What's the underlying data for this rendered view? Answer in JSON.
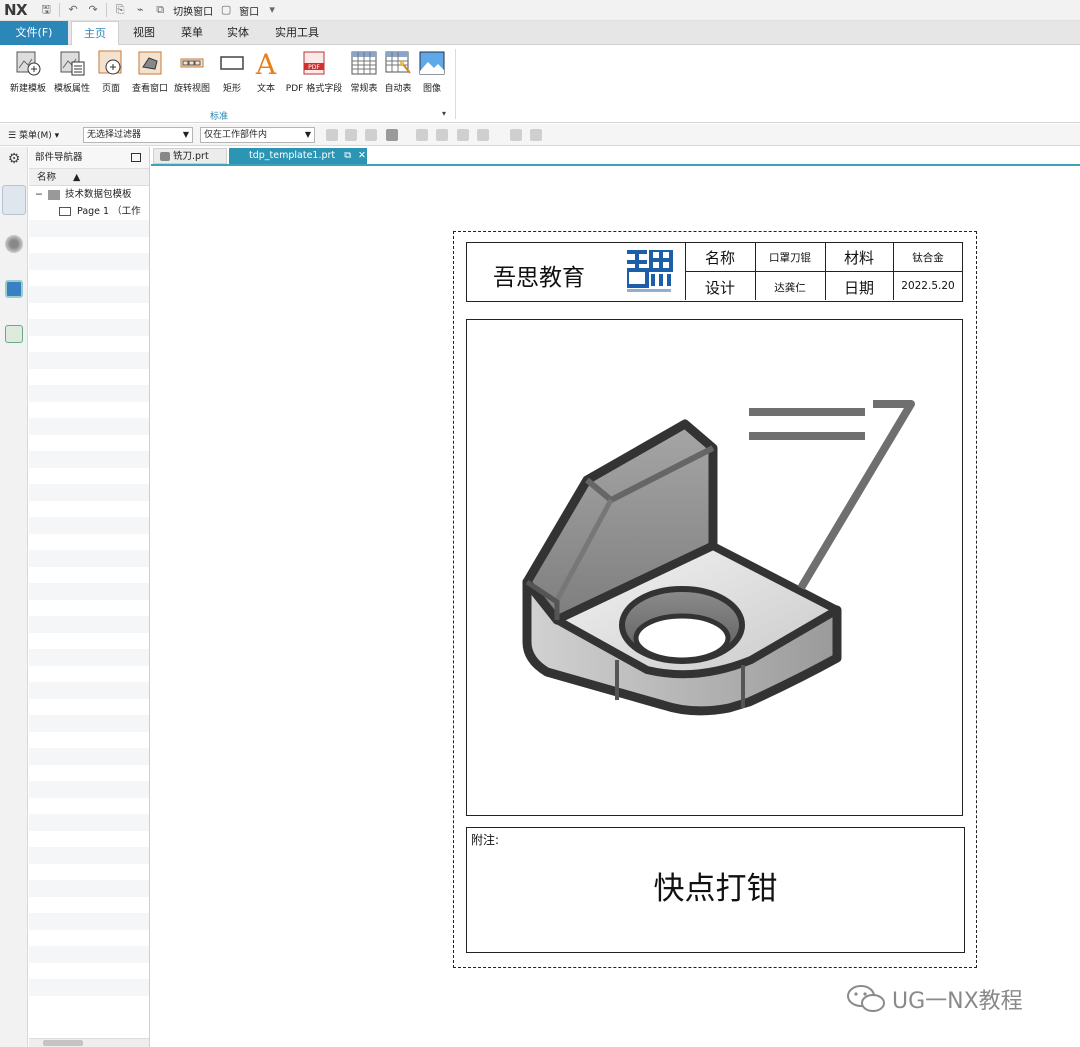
{
  "titlebar": {
    "logo": "NX",
    "switch_window": "切换窗口",
    "window_menu": "窗口"
  },
  "ribbon_tabs": [
    "文件(F)",
    "主页",
    "视图",
    "菜单",
    "实体",
    "实用工具"
  ],
  "ribbon": {
    "buttons": [
      "新建模板",
      "模板属性",
      "页面",
      "查看窗口",
      "旋转视图",
      "矩形",
      "文本",
      "PDF 格式字段",
      "常规表",
      "自动表",
      "图像"
    ],
    "group_label": "标准"
  },
  "cmdbar": {
    "menu_label": "菜单(M)",
    "filter_value": "无选择过滤器",
    "scope_value": "仅在工作部件内"
  },
  "navigator": {
    "title": "部件导航器",
    "column_header": "名称",
    "items": [
      "技术数据包模板",
      "Page 1 （工作"
    ]
  },
  "doc_tabs": [
    "铣刀.prt",
    "tdp_template1.prt"
  ],
  "sheet": {
    "company": "吾思教育",
    "labels": {
      "name_label": "名称",
      "name_value": "口罩刀锟",
      "material_label": "材料",
      "material_value": "钛合金",
      "design_label": "设计",
      "design_value": "达龚仁",
      "date_label": "日期",
      "date_value": "2022.5.20"
    },
    "note_label": "附注:",
    "note_text": "快点打钳"
  },
  "watermark": "UG一NX教程",
  "colors": {
    "accent": "#2c87b9",
    "tab_active": "#2d95b4",
    "logo_blue": "#1d5ea8"
  }
}
